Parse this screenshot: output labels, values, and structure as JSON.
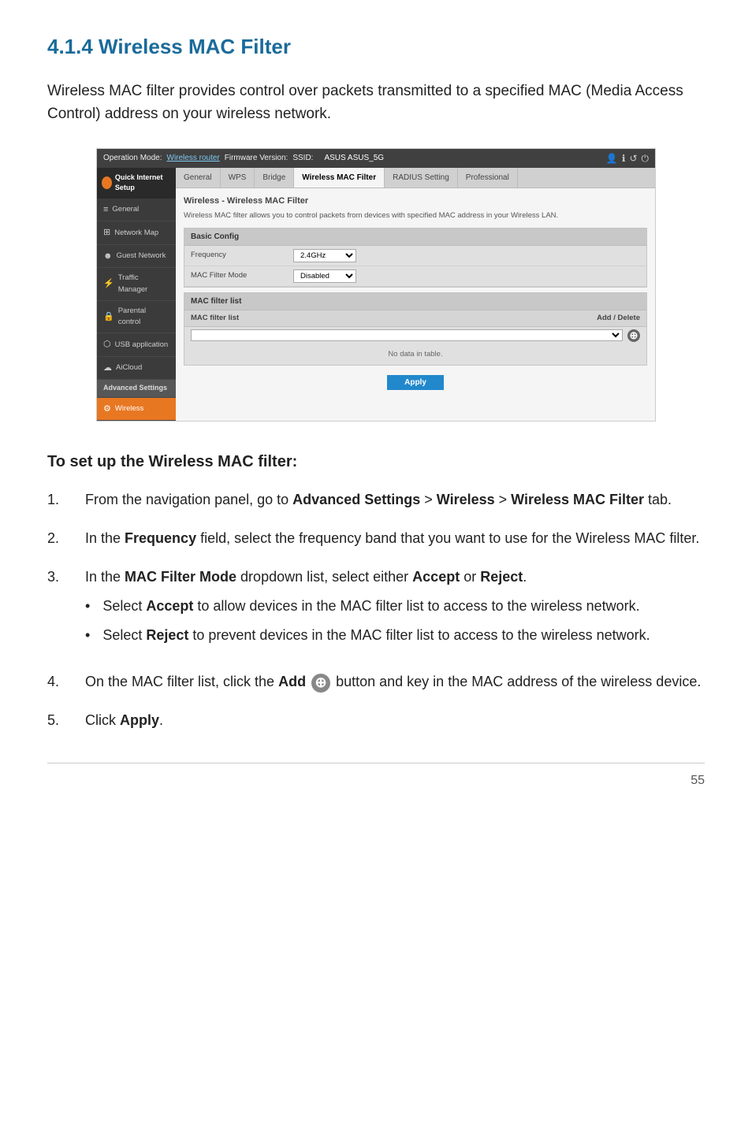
{
  "page": {
    "title": "4.1.4 Wireless MAC Filter",
    "page_number": "55"
  },
  "intro": {
    "text": "Wireless MAC filter provides control over packets transmitted to a specified MAC (Media Access Control) address on your wireless network."
  },
  "screenshot": {
    "topbar": {
      "operation_mode_label": "Operation Mode:",
      "operation_mode_link": "Wireless router",
      "firmware_label": "Firmware Version:",
      "ssid_label": "SSID:",
      "ssid_values": "ASUS  ASUS_5G"
    },
    "tabs": [
      "General",
      "WPS",
      "Bridge",
      "Wireless MAC Filter",
      "RADIUS Setting",
      "Professional"
    ],
    "active_tab": "Wireless MAC Filter",
    "sidebar": {
      "logo_text": "Quick Internet Setup",
      "items": [
        {
          "label": "General",
          "icon": "≡",
          "active": false
        },
        {
          "label": "Network Map",
          "icon": "⊞",
          "active": false
        },
        {
          "label": "Guest Network",
          "icon": "☻",
          "active": false
        },
        {
          "label": "Traffic Manager",
          "icon": "⚡",
          "active": false
        },
        {
          "label": "Parental control",
          "icon": "🔒",
          "active": false
        },
        {
          "label": "USB application",
          "icon": "⬡",
          "active": false
        },
        {
          "label": "AiCloud",
          "icon": "☁",
          "active": false
        },
        {
          "label": "Advanced Settings",
          "section": true
        },
        {
          "label": "Wireless",
          "icon": "⚙",
          "active": true
        }
      ]
    },
    "content": {
      "main_title": "Wireless - Wireless MAC Filter",
      "description": "Wireless MAC filter allows you to control packets from devices with specified MAC address in your Wireless LAN.",
      "basic_config_title": "Basic Config",
      "frequency_label": "Frequency",
      "frequency_value": "2.4GHz",
      "mac_filter_mode_label": "MAC Filter Mode",
      "mac_filter_mode_value": "Disabled",
      "mac_filter_list_title": "MAC filter list",
      "mac_filter_list_col": "MAC filter list",
      "mac_filter_add_delete": "Add / Delete",
      "no_data_text": "No data in table.",
      "apply_button": "Apply"
    }
  },
  "instructions": {
    "title": "To set up the Wireless MAC filter:",
    "steps": [
      {
        "text_parts": [
          "From the navigation panel, go to ",
          "Advanced Settings",
          " > ",
          "Wireless",
          " > ",
          "Wireless MAC Filter",
          " tab."
        ],
        "bold_indices": [
          1,
          3,
          5
        ]
      },
      {
        "text_parts": [
          "In the ",
          "Frequency",
          " field, select the frequency band that you want to use for the Wireless MAC filter."
        ],
        "bold_indices": [
          1
        ]
      },
      {
        "text_parts": [
          "In the ",
          "MAC Filter Mode",
          " dropdown list, select either ",
          "Accept",
          " or ",
          "Reject",
          "."
        ],
        "bold_indices": [
          1,
          3,
          5
        ]
      },
      {
        "bullet_items": [
          {
            "text_parts": [
              "Select ",
              "Accept",
              " to allow devices in the MAC filter list to access to the wireless network."
            ],
            "bold_indices": [
              1
            ]
          },
          {
            "text_parts": [
              "Select ",
              "Reject",
              " to prevent devices in the MAC filter list to access to the wireless network."
            ],
            "bold_indices": [
              1
            ]
          }
        ]
      },
      {
        "text_parts": [
          "On the MAC filter list, click the ",
          "Add",
          " ⊕ ",
          " button and key in the MAC address of the wireless device."
        ],
        "bold_indices": [
          1
        ],
        "has_add_icon": true
      },
      {
        "text_parts": [
          "Click ",
          "Apply",
          "."
        ],
        "bold_indices": [
          1
        ]
      }
    ]
  }
}
